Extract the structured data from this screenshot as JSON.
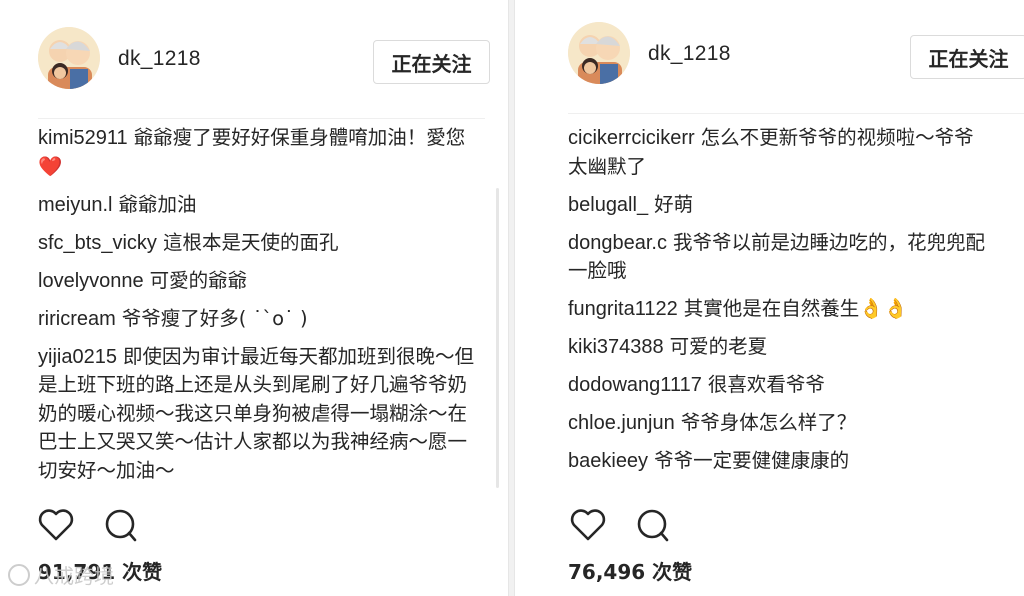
{
  "panels": [
    {
      "username": "dk_1218",
      "follow_label": "正在关注",
      "comments": [
        {
          "user": "kimi52911",
          "text": "爺爺瘦了要好好保重身體唷加油！愛您❤️"
        },
        {
          "user": "meiyun.l",
          "text": "爺爺加油"
        },
        {
          "user": "sfc_bts_vicky",
          "text": "這根本是天使的面孔"
        },
        {
          "user": "lovelyvonne",
          "text": "可愛的爺爺"
        },
        {
          "user": "riricream",
          "text": "爷爷瘦了好多( ˙`o˙ )"
        },
        {
          "user": "yijia0215",
          "text": "即使因为审计最近每天都加班到很晚～但是上班下班的路上还是从头到尾刷了好几遍爷爷奶奶的暖心视频～我这只单身狗被虐得一塌糊涂～在巴士上又哭又笑～估计人家都以为我神经病～愿一切安好～加油～"
        }
      ],
      "likes": "91,791 次赞",
      "icons": [
        "heart-icon",
        "comment-icon"
      ]
    },
    {
      "username": "dk_1218",
      "follow_label": "正在关注",
      "comments": [
        {
          "user": "cicikerrcicikerr",
          "text": "怎么不更新爷爷的视频啦～爷爷太幽默了"
        },
        {
          "user": "belugall_",
          "text": "好萌"
        },
        {
          "user": "dongbear.c",
          "text": "我爷爷以前是边睡边吃的，花兜兜配一脸哦"
        },
        {
          "user": "fungrita1122",
          "text": "其實他是在自然養生👌👌"
        },
        {
          "user": "kiki374388",
          "text": "可爱的老夏"
        },
        {
          "user": "dodowang1117",
          "text": "很喜欢看爷爷"
        },
        {
          "user": "chloe.junjun",
          "text": "爷爷身体怎么样了？"
        },
        {
          "user": "baekieey",
          "text": "爷爷一定要健健康康的"
        }
      ],
      "likes": "76,496 次赞",
      "icons": [
        "heart-icon",
        "comment-icon"
      ]
    }
  ],
  "watermark": "八戒跨境"
}
